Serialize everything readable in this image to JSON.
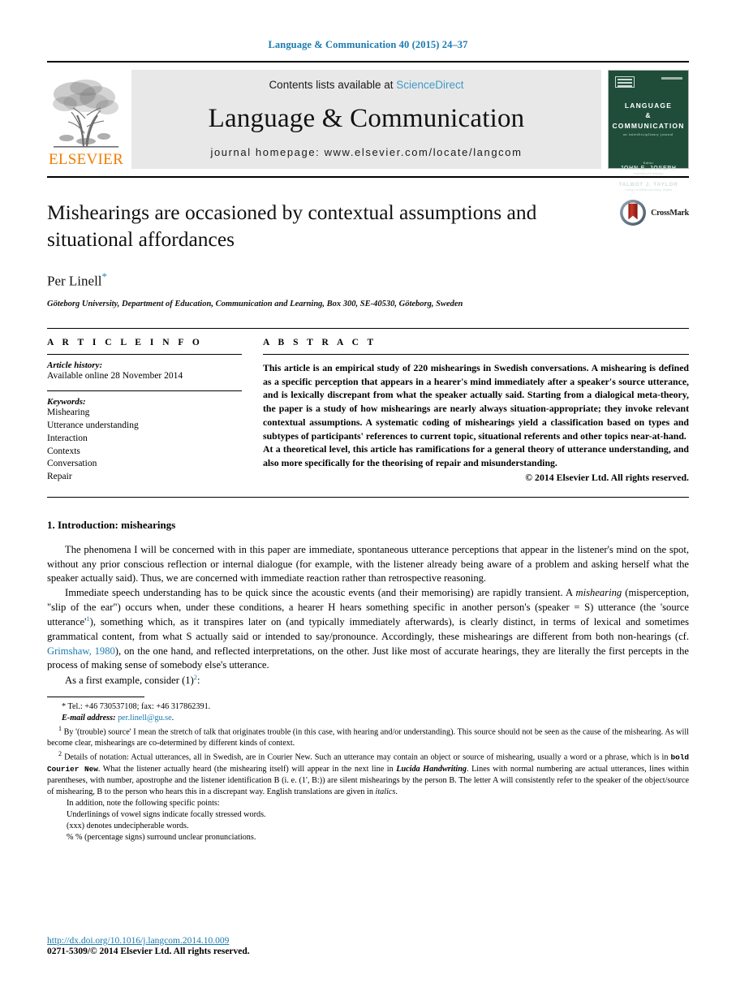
{
  "running_head": "Language & Communication 40 (2015) 24–37",
  "masthead": {
    "publisher_name": "ELSEVIER",
    "contents_prefix": "Contents lists available at ",
    "sciencedirect": "ScienceDirect",
    "journal_name": "Language & Communication",
    "homepage": "journal homepage: www.elsevier.com/locate/langcom",
    "cover": {
      "title_line1": "LANGUAGE",
      "title_line2": "&",
      "title_line3": "COMMUNICATION",
      "subtitle": "an interdisciplinary journal",
      "editor_label": "Editor",
      "editor_1": "JOHN E. JOSEPH",
      "editor_1_aff": "University of Edinburgh",
      "editor_2": "TALBOT J. TAYLOR",
      "editor_2_aff": "College of William and Mary, Virginia"
    }
  },
  "article": {
    "title": "Mishearings are occasioned by contextual assumptions and situational affordances",
    "author": "Per Linell",
    "author_marker": "*",
    "affiliation": "Göteborg University, Department of Education, Communication and Learning, Box 300, SE-40530, Göteborg, Sweden",
    "crossmark_label": "CrossMark"
  },
  "article_info": {
    "heading": "A R T I C L E   I N F O",
    "history_label": "Article history:",
    "history_value": "Available online 28 November 2014",
    "keywords_label": "Keywords:",
    "keywords": [
      "Mishearing",
      "Utterance understanding",
      "Interaction",
      "Contexts",
      "Conversation",
      "Repair"
    ]
  },
  "abstract": {
    "heading": "A B S T R A C T",
    "paragraph_1": "This article is an empirical study of 220 mishearings in Swedish conversations. A mishearing is defined as a specific perception that appears in a hearer's mind immediately after a speaker's source utterance, and is lexically discrepant from what the speaker actually said. Starting from a dialogical meta-theory, the paper is a study of how mishearings are nearly always situation-appropriate; they invoke relevant contextual assumptions. A systematic coding of mishearings yield a classification based on types and subtypes of participants' references to current topic, situational referents and other topics near-at-hand.",
    "paragraph_2": "At a theoretical level, this article has ramifications for a general theory of utterance understanding, and also more specifically for the theorising of repair and misunderstanding.",
    "copyright": "© 2014 Elsevier Ltd. All rights reserved."
  },
  "body": {
    "section_heading": "1. Introduction: mishearings",
    "p1": "The phenomena I will be concerned with in this paper are immediate, spontaneous utterance perceptions that appear in the listener's mind on the spot, without any prior conscious reflection or internal dialogue (for example, with the listener already being aware of a problem and asking herself what the speaker actually said). Thus, we are concerned with immediate reaction rather than retrospective reasoning.",
    "p2_a": "Immediate speech understanding has to be quick since the acoustic events (and their memorising) are rapidly transient. A ",
    "p2_italic": "mishearing",
    "p2_b": " (misperception, \"slip of the ear\") occurs when, under these conditions, a hearer H hears something specific in another person's (speaker = S) utterance (the 'source utterance'",
    "p2_fn": "1",
    "p2_c": "), something which, as it transpires later on (and typically immediately afterwards), is clearly distinct, in terms of lexical and sometimes grammatical content, from what S actually said or intended to say/pronounce. Accordingly, these mishearings are different from both non-hearings (cf. ",
    "p2_cite": "Grimshaw, 1980",
    "p2_d": "), on the one hand, and reflected interpretations, on the other. Just like most of accurate hearings, they are literally the first percepts in the process of making sense of somebody else's utterance.",
    "p3_a": "As a first example, consider (1)",
    "p3_fn": "2",
    "p3_b": ":"
  },
  "footnotes": {
    "star_marker": "*",
    "star_text": "Tel.: +46 730537108; fax: +46 317862391.",
    "email_label": "E-mail address:",
    "email": "per.linell@gu.se",
    "email_trail": ".",
    "fn1_marker": "1",
    "fn1_text": "By '(trouble) source' I mean the stretch of talk that originates trouble (in this case, with hearing and/or understanding). This source should not be seen as the cause of the mishearing. As will become clear, mishearings are co-determined by different kinds of context.",
    "fn2_marker": "2",
    "fn2_a": "Details of notation: Actual utterances, all in Swedish, are in Courier New. Such an utterance may contain an object or source of mishearing, usually a word or a phrase, which is in ",
    "fn2_mono": "bold Courier New",
    "fn2_b": ". What the listener actually heard (the mishearing itself) will appear in the next line in ",
    "fn2_hand": "Lucida Handwriting",
    "fn2_c": ". Lines with normal numbering are actual utterances, lines within parentheses, with number, apostrophe and the listener identification B (i. e. (1', B:)) are silent mishearings by the person B. The letter A will consistently refer to the speaker of the object/source of mishearing, B to the person who hears this in a discrepant way. English translations are given in ",
    "fn2_italics": "italics",
    "fn2_d": ".",
    "notes": [
      "In addition, note the following specific points:",
      "Underlinings of vowel signs indicate focally stressed words.",
      "(xxx) denotes undecipherable words.",
      "% % (percentage signs) surround unclear pronunciations."
    ]
  },
  "bottom": {
    "doi": "http://dx.doi.org/10.1016/j.langcom.2014.10.009",
    "issn_line": "0271-5309/© 2014 Elsevier Ltd. All rights reserved."
  },
  "colors": {
    "link_blue": "#1a7bb0",
    "sciencedirect_blue": "#3d9bc7",
    "elsevier_orange": "#ef7d00",
    "cover_green": "#1f4d3a",
    "crossmark_red": "#b4261a"
  }
}
